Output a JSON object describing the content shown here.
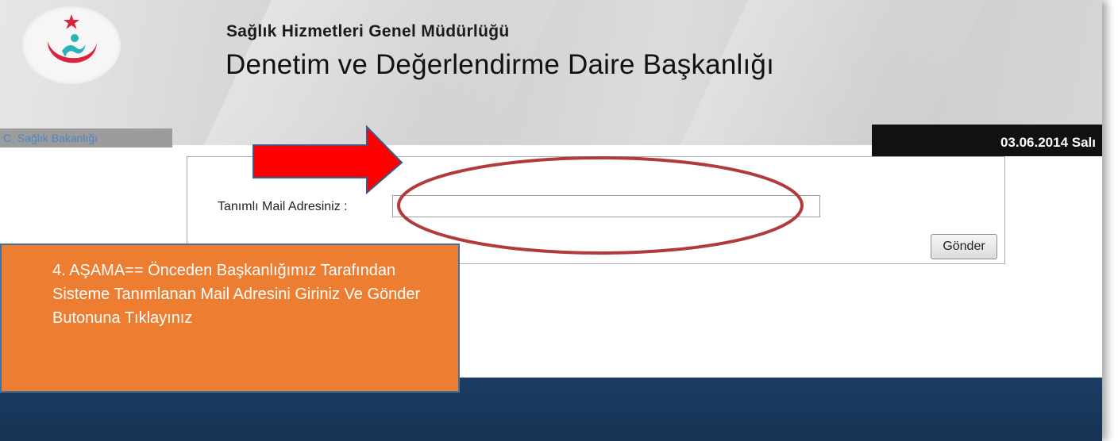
{
  "header": {
    "subtitle": "Sağlık Hizmetleri Genel Müdürlüğü",
    "title": "Denetim ve Değerlendirme Daire Başkanlığı",
    "ministry_label": "C. Sağlık Bakanlığı",
    "date": "03.06.2014 Salı",
    "logo_icon": "ministry-of-health-logo-icon"
  },
  "form": {
    "mail_label": "Tanımlı Mail Adresiniz :",
    "mail_value": "",
    "mail_placeholder": "",
    "send_label": "Gönder"
  },
  "annotation": {
    "text": "4. AŞAMA== Önceden Başkanlığımız Tarafından Sisteme Tanımlanan Mail Adresini Giriniz Ve Gönder Butonuna Tıklayınız",
    "arrow_icon": "red-right-arrow-icon",
    "highlight_icon": "red-ellipse-highlight-icon"
  },
  "colors": {
    "annotation_bg": "#ed7d31",
    "annotation_border": "#41719c",
    "arrow_fill": "#ff0000",
    "ellipse_stroke": "#b33a3a",
    "footer_bg": "#1c3c63",
    "ministry_text": "#4e84c4",
    "logo_red": "#d7263d",
    "logo_teal": "#2ab3b7"
  }
}
